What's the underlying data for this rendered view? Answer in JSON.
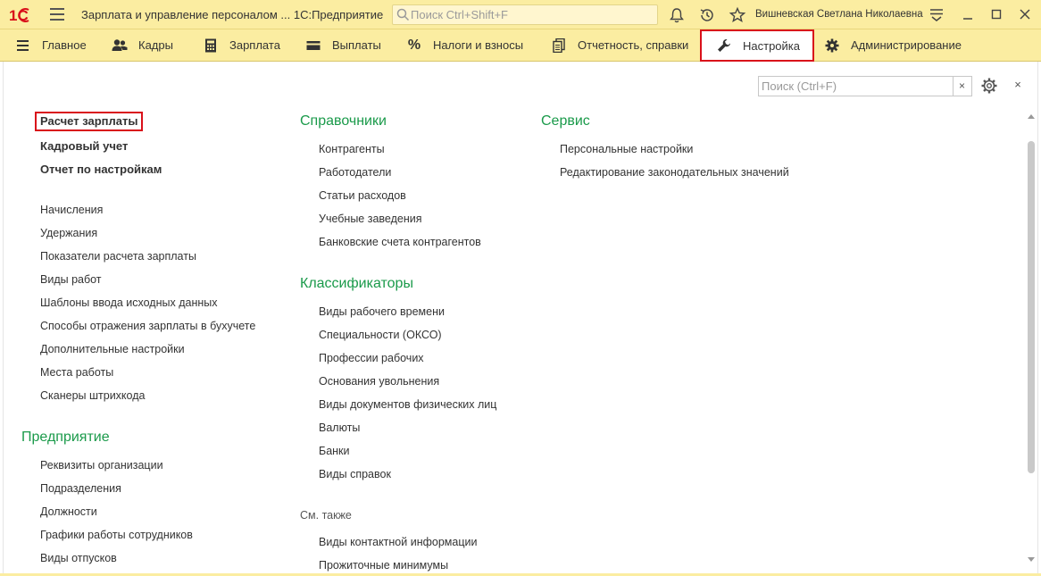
{
  "titlebar": {
    "logo_text": "1С",
    "app_title": "Зарплата и управление персоналом ...  1С:Предприятие",
    "search_placeholder": "Поиск Ctrl+Shift+F",
    "user_name": "Вишневская Светлана Николаевна"
  },
  "sections": [
    {
      "label": "Главное",
      "icon": "hamburger-icon"
    },
    {
      "label": "Кадры",
      "icon": "people-icon"
    },
    {
      "label": "Зарплата",
      "icon": "calculator-icon"
    },
    {
      "label": "Выплаты",
      "icon": "wallet-icon"
    },
    {
      "label": "Налоги и взносы",
      "icon": "percent-icon"
    },
    {
      "label": "Отчетность, справки",
      "icon": "documents-icon"
    },
    {
      "label": "Настройка",
      "icon": "wrench-icon",
      "active": true
    },
    {
      "label": "Администрирование",
      "icon": "gear-icon"
    }
  ],
  "content": {
    "search_placeholder": "Поиск (Ctrl+F)",
    "clear_label": "×",
    "close_label": "×",
    "col1": {
      "top_links": [
        "Расчет зарплаты",
        "Кадровый учет",
        "Отчет по настройкам"
      ],
      "links": [
        "Начисления",
        "Удержания",
        "Показатели расчета зарплаты",
        "Виды работ",
        "Шаблоны ввода исходных данных",
        "Способы отражения зарплаты в бухучете",
        "Дополнительные настройки",
        "Места работы",
        "Сканеры штрихкода"
      ],
      "group2_title": "Предприятие",
      "group2_links": [
        "Реквизиты организации",
        "Подразделения",
        "Должности",
        "Графики работы сотрудников",
        "Виды отпусков"
      ]
    },
    "col2": {
      "group1_title": "Справочники",
      "group1_links": [
        "Контрагенты",
        "Работодатели",
        "Статьи расходов",
        "Учебные заведения",
        "Банковские счета контрагентов"
      ],
      "group2_title": "Классификаторы",
      "group2_links": [
        "Виды рабочего времени",
        "Специальности (ОКСО)",
        "Профессии рабочих",
        "Основания увольнения",
        "Виды документов физических лиц",
        "Валюты",
        "Банки",
        "Виды справок"
      ],
      "see_also_title": "См. также",
      "see_also_links": [
        "Виды контактной информации",
        "Прожиточные минимумы"
      ]
    },
    "col3": {
      "group1_title": "Сервис",
      "group1_links": [
        "Персональные настройки",
        "Редактирование законодательных значений"
      ]
    }
  },
  "colors": {
    "accent_bar": "#fbeda1",
    "group_title": "#1a9a4a",
    "highlight": "#d9101a"
  }
}
